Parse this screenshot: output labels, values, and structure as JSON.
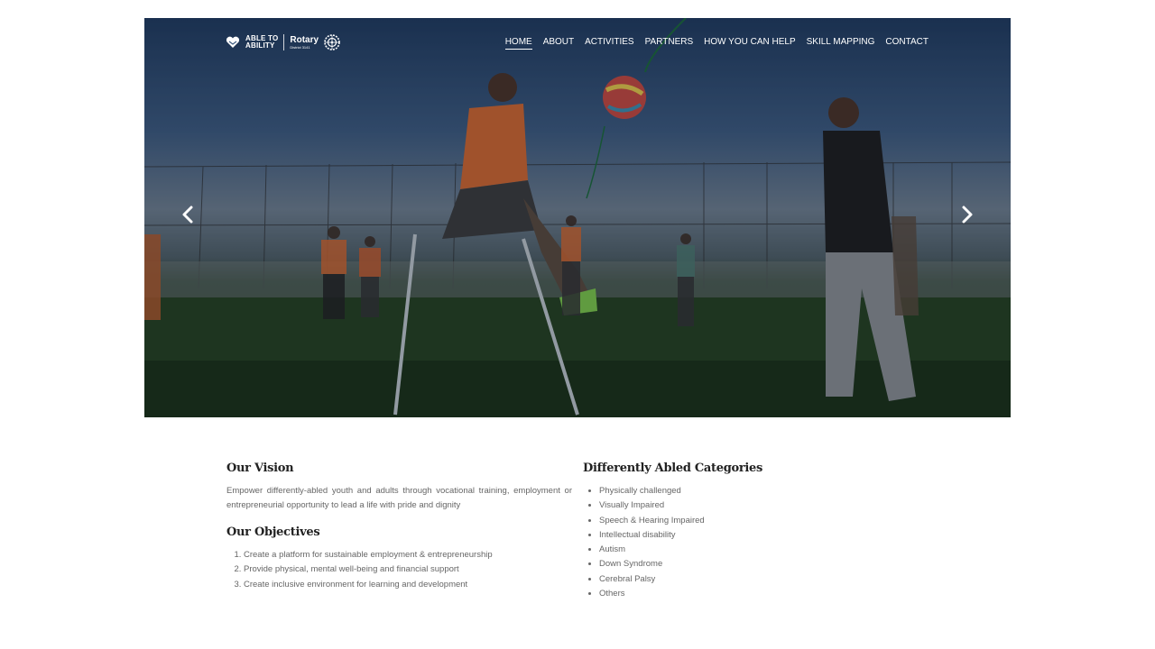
{
  "brand": {
    "logo_line1": "ABLE TO",
    "logo_line2": "ABILITY",
    "partner_name": "Rotary",
    "partner_sub": "District 3141"
  },
  "nav": {
    "items": [
      {
        "label": "HOME",
        "active": true
      },
      {
        "label": "ABOUT"
      },
      {
        "label": "ACTIVITIES"
      },
      {
        "label": "PARTNERS"
      },
      {
        "label": "HOW YOU CAN HELP"
      },
      {
        "label": "SKILL MAPPING"
      },
      {
        "label": "CONTACT"
      }
    ]
  },
  "hero": {
    "prev_icon": "chevron-left-icon",
    "next_icon": "chevron-right-icon"
  },
  "vision": {
    "title": "Our Vision",
    "text": "Empower differently-abled youth and adults through vocational training, employment or entrepreneurial opportunity to lead a life with pride and dignity"
  },
  "objectives": {
    "title": "Our Objectives",
    "items": [
      "Create a platform for sustainable employment & entrepreneurship",
      "Provide physical, mental well-being and financial support",
      "Create inclusive environment for learning and development"
    ]
  },
  "categories": {
    "title": "Differently Abled Categories",
    "items": [
      "Physically challenged",
      "Visually Impaired",
      "Speech & Hearing Impaired",
      "Intellectual disability",
      "Autism",
      "Down Syndrome",
      "Cerebral Palsy",
      "Others"
    ]
  }
}
